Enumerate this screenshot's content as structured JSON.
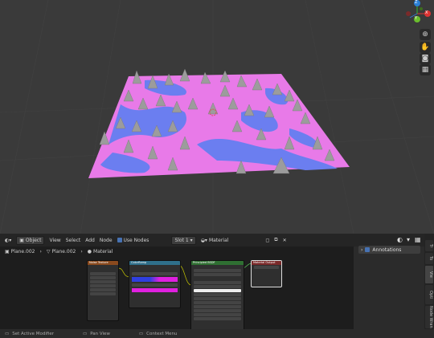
{
  "header": {
    "mode": "Object",
    "menus": [
      "View",
      "Select",
      "Add",
      "Node"
    ],
    "use_nodes": "Use Nodes",
    "slot": "Slot 1",
    "material": "Material"
  },
  "breadcrumb": {
    "object": "Plane.002",
    "mesh": "Plane.002",
    "material": "Material"
  },
  "sidepanel": {
    "annotations": "Annotations",
    "tabs": [
      "Tr",
      "To",
      "Vie",
      "Opti",
      "Node Wran"
    ]
  },
  "gizmo": {
    "x": "X",
    "y": "Y",
    "z": "Z"
  },
  "colors": {
    "terrain_pink": "#e87ae8",
    "terrain_blue": "#6b7ef0",
    "spikes": "#9c9c9c",
    "node_orange": "#8a4a1e",
    "node_blue": "#2f6f8a",
    "node_green": "#2f6f32",
    "node_red": "#7a2a2a"
  },
  "nodes": {
    "noise": "Noise Texture",
    "ramp": "ColorRamp",
    "bsdf": "Principled BSDF",
    "output": "Material Output"
  },
  "status": [
    "Set Active Modifier",
    "Pan View",
    "Context Menu"
  ]
}
